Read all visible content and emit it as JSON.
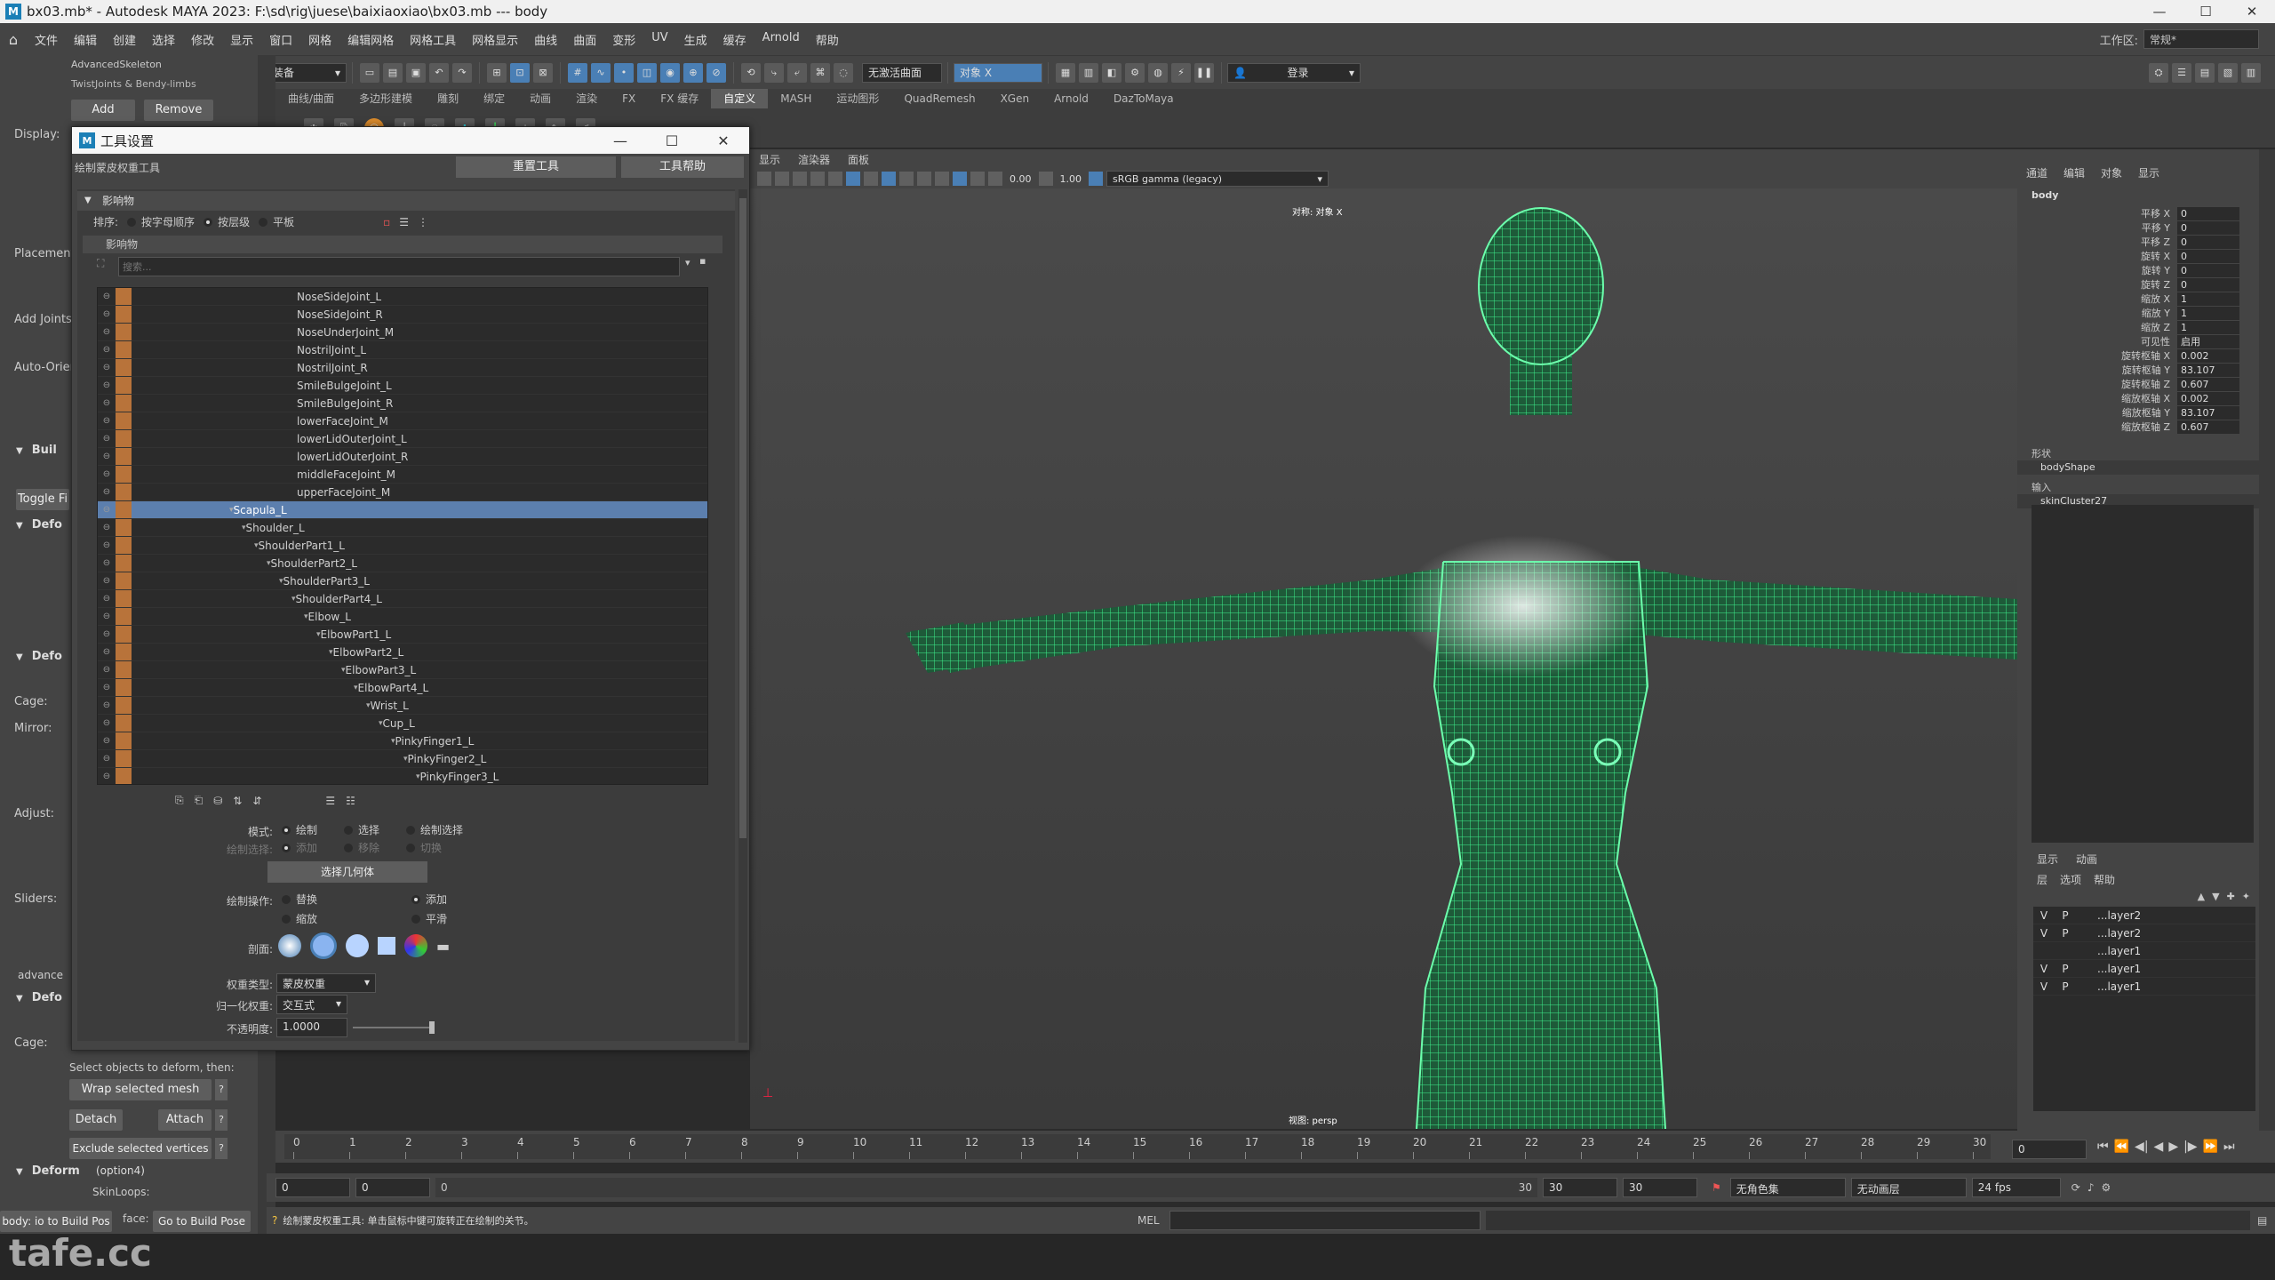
{
  "window": {
    "title": "bx03.mb* - Autodesk MAYA 2023: F:\\sd\\rig\\juese\\baixiaoxiao\\bx03.mb   ---   body",
    "controls": [
      "—",
      "☐",
      "✕"
    ]
  },
  "menubar": {
    "items": [
      "文件",
      "编辑",
      "创建",
      "选择",
      "修改",
      "显示",
      "窗口",
      "网格",
      "编辑网格",
      "网格工具",
      "网格显示",
      "曲线",
      "曲面",
      "变形",
      "UV",
      "生成",
      "缓存",
      "Arnold",
      "帮助"
    ],
    "workspace_label": "工作区:",
    "workspace_value": "常规*"
  },
  "statusline": {
    "mode": "装备",
    "no_live": "无激活曲面",
    "object_field": "对象 X",
    "login": "登录"
  },
  "shelf": {
    "tabs": [
      "曲线/曲面",
      "多边形建模",
      "雕刻",
      "绑定",
      "动画",
      "渲染",
      "FX",
      "FX 缓存",
      "自定义",
      "MASH",
      "运动图形",
      "QuadRemesh",
      "XGen",
      "Arnold",
      "DazToMaya"
    ],
    "active_index": 8
  },
  "advskel": {
    "title": "AdvancedSkeleton",
    "subtitle": "TwistJoints & Bendy-limbs",
    "add": "Add",
    "remove": "Remove",
    "labels": {
      "display": "Display:",
      "placement": "Placement:",
      "add_joints": "Add Joints",
      "auto_orient": "Auto-Orien",
      "cage": "Cage:",
      "mirror": "Mirror:",
      "adjust": "Adjust:",
      "sliders": "Sliders:",
      "cage2": "Cage:",
      "advanced": "advance"
    },
    "sections": {
      "build": "Buil",
      "deform1": "Defo",
      "deform2": "Defo",
      "deform3": "Defo"
    },
    "toggle": "Toggle Fi",
    "select_hint": "Select objects to deform, then:",
    "wrap": "Wrap selected mesh",
    "detach": "Detach",
    "attach": "Attach",
    "exclude": "Exclude selected vertices",
    "deform_opt": "Deform",
    "deform_opt_note": "(option4)",
    "skinloops": "SkinLoops:",
    "go_build_body": "body: io to Build Pos",
    "face_label": "face:",
    "go_build_face": "Go to Build Pose"
  },
  "toolsettings": {
    "title": "工具设置",
    "tool_name": "绘制蒙皮权重工具",
    "reset": "重置工具",
    "help": "工具帮助",
    "influences_frame": "影响物",
    "sort_label": "排序:",
    "sort_options": [
      "按字母顺序",
      "按层级",
      "平板"
    ],
    "influences_sub": "影响物",
    "search_placeholder": "搜索...",
    "joints": [
      {
        "name": "NoseSideJoint_L",
        "indent": 0
      },
      {
        "name": "NoseSideJoint_R",
        "indent": 0
      },
      {
        "name": "NoseUnderJoint_M",
        "indent": 0
      },
      {
        "name": "NostrilJoint_L",
        "indent": 0
      },
      {
        "name": "NostrilJoint_R",
        "indent": 0
      },
      {
        "name": "SmileBulgeJoint_L",
        "indent": 0
      },
      {
        "name": "SmileBulgeJoint_R",
        "indent": 0
      },
      {
        "name": "lowerFaceJoint_M",
        "indent": 0
      },
      {
        "name": "lowerLidOuterJoint_L",
        "indent": 0
      },
      {
        "name": "lowerLidOuterJoint_R",
        "indent": 0
      },
      {
        "name": "middleFaceJoint_M",
        "indent": 0
      },
      {
        "name": "upperFaceJoint_M",
        "indent": 0
      },
      {
        "name": "Scapula_L",
        "indent": 1,
        "selected": true
      },
      {
        "name": "Shoulder_L",
        "indent": 2
      },
      {
        "name": "ShoulderPart1_L",
        "indent": 3
      },
      {
        "name": "ShoulderPart2_L",
        "indent": 4
      },
      {
        "name": "ShoulderPart3_L",
        "indent": 5
      },
      {
        "name": "ShoulderPart4_L",
        "indent": 6
      },
      {
        "name": "Elbow_L",
        "indent": 7
      },
      {
        "name": "ElbowPart1_L",
        "indent": 8
      },
      {
        "name": "ElbowPart2_L",
        "indent": 9
      },
      {
        "name": "ElbowPart3_L",
        "indent": 10
      },
      {
        "name": "ElbowPart4_L",
        "indent": 11
      },
      {
        "name": "Wrist_L",
        "indent": 12
      },
      {
        "name": "Cup_L",
        "indent": 13
      },
      {
        "name": "PinkyFinger1_L",
        "indent": 14
      },
      {
        "name": "PinkyFinger2_L",
        "indent": 15
      },
      {
        "name": "PinkyFinger3_L",
        "indent": 16
      }
    ],
    "mode_label": "模式:",
    "mode_options": [
      "绘制",
      "选择",
      "绘制选择"
    ],
    "paint_select_label": "绘制选择:",
    "paint_select_options": [
      "添加",
      "移除",
      "切换"
    ],
    "select_geo": "选择几何体",
    "paint_op_label": "绘制操作:",
    "paint_ops": [
      "替换",
      "添加",
      "缩放",
      "平滑"
    ],
    "profile_label": "剖面:",
    "weight_type_label": "权重类型:",
    "weight_type": "蒙皮权重",
    "normalize_label": "归一化权重:",
    "normalize": "交互式",
    "opacity_label": "不透明度:",
    "opacity": "1.0000"
  },
  "viewport": {
    "menus": [
      "显示",
      "渲染器",
      "面板"
    ],
    "gamma": "sRGB gamma (legacy)",
    "num1": "0.00",
    "num2": "1.00",
    "top_label": "对称: 对象 X",
    "camera_label": "视图: persp"
  },
  "channelbox": {
    "tabs": [
      "通道",
      "编辑",
      "对象",
      "显示"
    ],
    "object": "body",
    "attrs": [
      {
        "n": "平移 X",
        "v": "0"
      },
      {
        "n": "平移 Y",
        "v": "0"
      },
      {
        "n": "平移 Z",
        "v": "0"
      },
      {
        "n": "旋转 X",
        "v": "0"
      },
      {
        "n": "旋转 Y",
        "v": "0"
      },
      {
        "n": "旋转 Z",
        "v": "0"
      },
      {
        "n": "缩放 X",
        "v": "1"
      },
      {
        "n": "缩放 Y",
        "v": "1"
      },
      {
        "n": "缩放 Z",
        "v": "1"
      },
      {
        "n": "可见性",
        "v": "启用"
      },
      {
        "n": "旋转枢轴 X",
        "v": "0.002"
      },
      {
        "n": "旋转枢轴 Y",
        "v": "83.107"
      },
      {
        "n": "旋转枢轴 Z",
        "v": "0.607"
      },
      {
        "n": "缩放枢轴 X",
        "v": "0.002"
      },
      {
        "n": "缩放枢轴 Y",
        "v": "83.107"
      },
      {
        "n": "缩放枢轴 Z",
        "v": "0.607"
      }
    ],
    "shapes_label": "形状",
    "shape": "bodyShape",
    "inputs_label": "输入",
    "input": "skinCluster27"
  },
  "layers": {
    "tabs": [
      "显示",
      "动画"
    ],
    "menus": [
      "层",
      "选项",
      "帮助"
    ],
    "rows": [
      {
        "v": "V",
        "p": "P",
        "name": "...layer2"
      },
      {
        "v": "V",
        "p": "P",
        "name": "...layer2"
      },
      {
        "v": "",
        "p": "",
        "name": "...layer1"
      },
      {
        "v": "V",
        "p": "P",
        "name": "...layer1"
      },
      {
        "v": "V",
        "p": "P",
        "name": "...layer1"
      }
    ]
  },
  "timeline": {
    "ticks": [
      "0",
      "1",
      "2",
      "3",
      "4",
      "5",
      "6",
      "7",
      "8",
      "9",
      "10",
      "11",
      "12",
      "13",
      "14",
      "15",
      "16",
      "17",
      "18",
      "19",
      "20",
      "21",
      "22",
      "23",
      "24",
      "25",
      "26",
      "27",
      "28",
      "29",
      "30"
    ],
    "current": "0",
    "range_start": "0",
    "range_start2": "0",
    "range_inner_start": "0",
    "range_inner_end": "30",
    "range_end": "30",
    "range_end2": "30",
    "char_set": "无角色集",
    "anim_layer": "无动画层",
    "fps": "24 fps"
  },
  "commandline": {
    "lang": "MEL",
    "help": "绘制蒙皮权重工具: 单击鼠标中键可旋转正在绘制的关节。"
  },
  "watermark": "tafe.cc"
}
